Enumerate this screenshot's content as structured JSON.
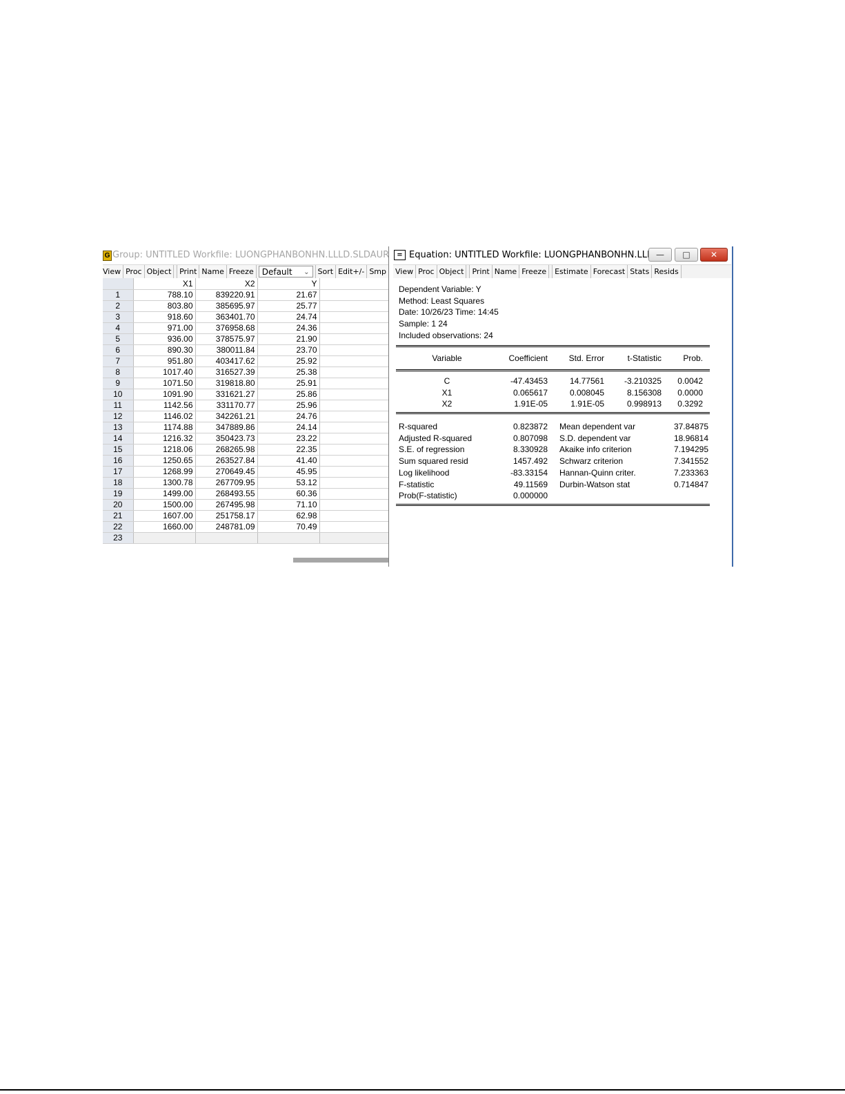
{
  "group_window": {
    "icon_letter": "G",
    "title": "Group: UNTITLED   Workfile: LUONGPHANBONHN.LLLD.SLDAUR...",
    "toolbar": [
      "View",
      "Proc",
      "Object",
      "Print",
      "Name",
      "Freeze"
    ],
    "view_select": "Default",
    "toolbar_right": [
      "Sort",
      "Edit+/-",
      "Smp"
    ],
    "columns": [
      "X1",
      "X2",
      "Y"
    ],
    "rows": [
      [
        "1",
        "788.10",
        "839220.91",
        "21.67"
      ],
      [
        "2",
        "803.80",
        "385695.97",
        "25.77"
      ],
      [
        "3",
        "918.60",
        "363401.70",
        "24.74"
      ],
      [
        "4",
        "971.00",
        "376958.68",
        "24.36"
      ],
      [
        "5",
        "936.00",
        "378575.97",
        "21.90"
      ],
      [
        "6",
        "890.30",
        "380011.84",
        "23.70"
      ],
      [
        "7",
        "951.80",
        "403417.62",
        "25.92"
      ],
      [
        "8",
        "1017.40",
        "316527.39",
        "25.38"
      ],
      [
        "9",
        "1071.50",
        "319818.80",
        "25.91"
      ],
      [
        "10",
        "1091.90",
        "331621.27",
        "25.86"
      ],
      [
        "11",
        "1142.56",
        "331170.77",
        "25.96"
      ],
      [
        "12",
        "1146.02",
        "342261.21",
        "24.76"
      ],
      [
        "13",
        "1174.88",
        "347889.86",
        "24.14"
      ],
      [
        "14",
        "1216.32",
        "350423.73",
        "23.22"
      ],
      [
        "15",
        "1218.06",
        "268265.98",
        "22.35"
      ],
      [
        "16",
        "1250.65",
        "263527.84",
        "41.40"
      ],
      [
        "17",
        "1268.99",
        "270649.45",
        "45.95"
      ],
      [
        "18",
        "1300.78",
        "267709.95",
        "53.12"
      ],
      [
        "19",
        "1499.00",
        "268493.55",
        "60.36"
      ],
      [
        "20",
        "1500.00",
        "267495.98",
        "71.10"
      ],
      [
        "21",
        "1607.00",
        "251758.17",
        "62.98"
      ],
      [
        "22",
        "1660.00",
        "248781.09",
        "70.49"
      ]
    ],
    "last_row_label": "23"
  },
  "equation_window": {
    "icon_symbol": "=",
    "title": "Equation: UNTITLED   Workfile: LUONGPHANBONHN.LLL...",
    "window_buttons": {
      "minimize": "—",
      "maximize": "□",
      "close": "✕"
    },
    "toolbar_left": [
      "View",
      "Proc",
      "Object"
    ],
    "toolbar_mid": [
      "Print",
      "Name",
      "Freeze"
    ],
    "toolbar_right": [
      "Estimate",
      "Forecast",
      "Stats",
      "Resids"
    ],
    "header_lines": [
      "Dependent Variable: Y",
      "Method: Least Squares",
      "Date: 10/26/23   Time: 14:45",
      "Sample: 1 24",
      "Included observations: 24"
    ],
    "coef_headers": [
      "Variable",
      "Coefficient",
      "Std. Error",
      "t-Statistic",
      "Prob."
    ],
    "coef_rows": [
      [
        "C",
        "-47.43453",
        "14.77561",
        "-3.210325",
        "0.0042"
      ],
      [
        "X1",
        "0.065617",
        "0.008045",
        "8.156308",
        "0.0000"
      ],
      [
        "X2",
        "1.91E-05",
        "1.91E-05",
        "0.998913",
        "0.3292"
      ]
    ],
    "stats_rows": [
      [
        "R-squared",
        "0.823872",
        "Mean dependent var",
        "37.84875"
      ],
      [
        "Adjusted R-squared",
        "0.807098",
        "S.D. dependent var",
        "18.96814"
      ],
      [
        "S.E. of regression",
        "8.330928",
        "Akaike info criterion",
        "7.194295"
      ],
      [
        "Sum squared resid",
        "1457.492",
        "Schwarz criterion",
        "7.341552"
      ],
      [
        "Log likelihood",
        "-83.33154",
        "Hannan-Quinn criter.",
        "7.233363"
      ],
      [
        "F-statistic",
        "49.11569",
        "Durbin-Watson stat",
        "0.714847"
      ],
      [
        "Prob(F-statistic)",
        "0.000000",
        "",
        ""
      ]
    ]
  }
}
